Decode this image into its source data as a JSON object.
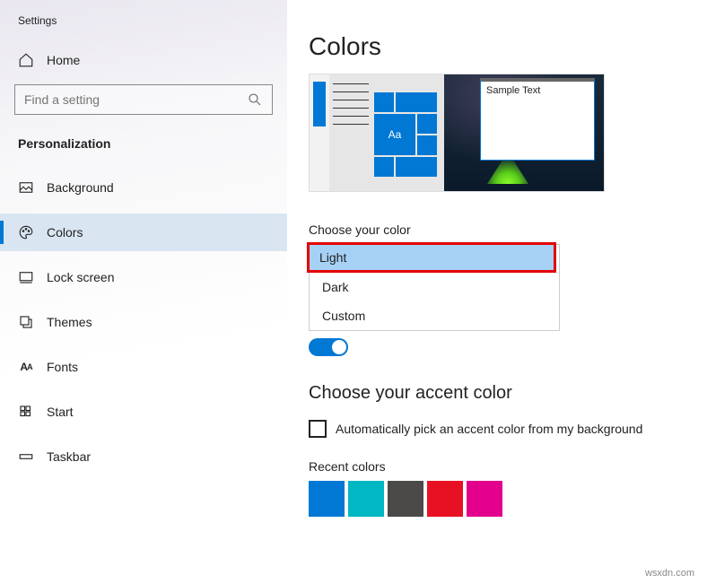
{
  "app_title": "Settings",
  "home_label": "Home",
  "search": {
    "placeholder": "Find a setting"
  },
  "section": "Personalization",
  "nav": [
    {
      "label": "Background"
    },
    {
      "label": "Colors"
    },
    {
      "label": "Lock screen"
    },
    {
      "label": "Themes"
    },
    {
      "label": "Fonts"
    },
    {
      "label": "Start"
    },
    {
      "label": "Taskbar"
    }
  ],
  "main": {
    "title": "Colors",
    "preview_window_text": "Sample Text",
    "preview_tile_label": "Aa",
    "choose_color_label": "Choose your color",
    "options": [
      "Light",
      "Dark",
      "Custom"
    ],
    "toggle_partial": "On",
    "accent_heading": "Choose your accent color",
    "auto_pick": "Automatically pick an accent color from my background",
    "recent_label": "Recent colors",
    "recent_colors": [
      "#0078d4",
      "#00b7c3",
      "#4c4a48",
      "#e81123",
      "#e3008c"
    ]
  },
  "watermark": "wsxdn.com"
}
